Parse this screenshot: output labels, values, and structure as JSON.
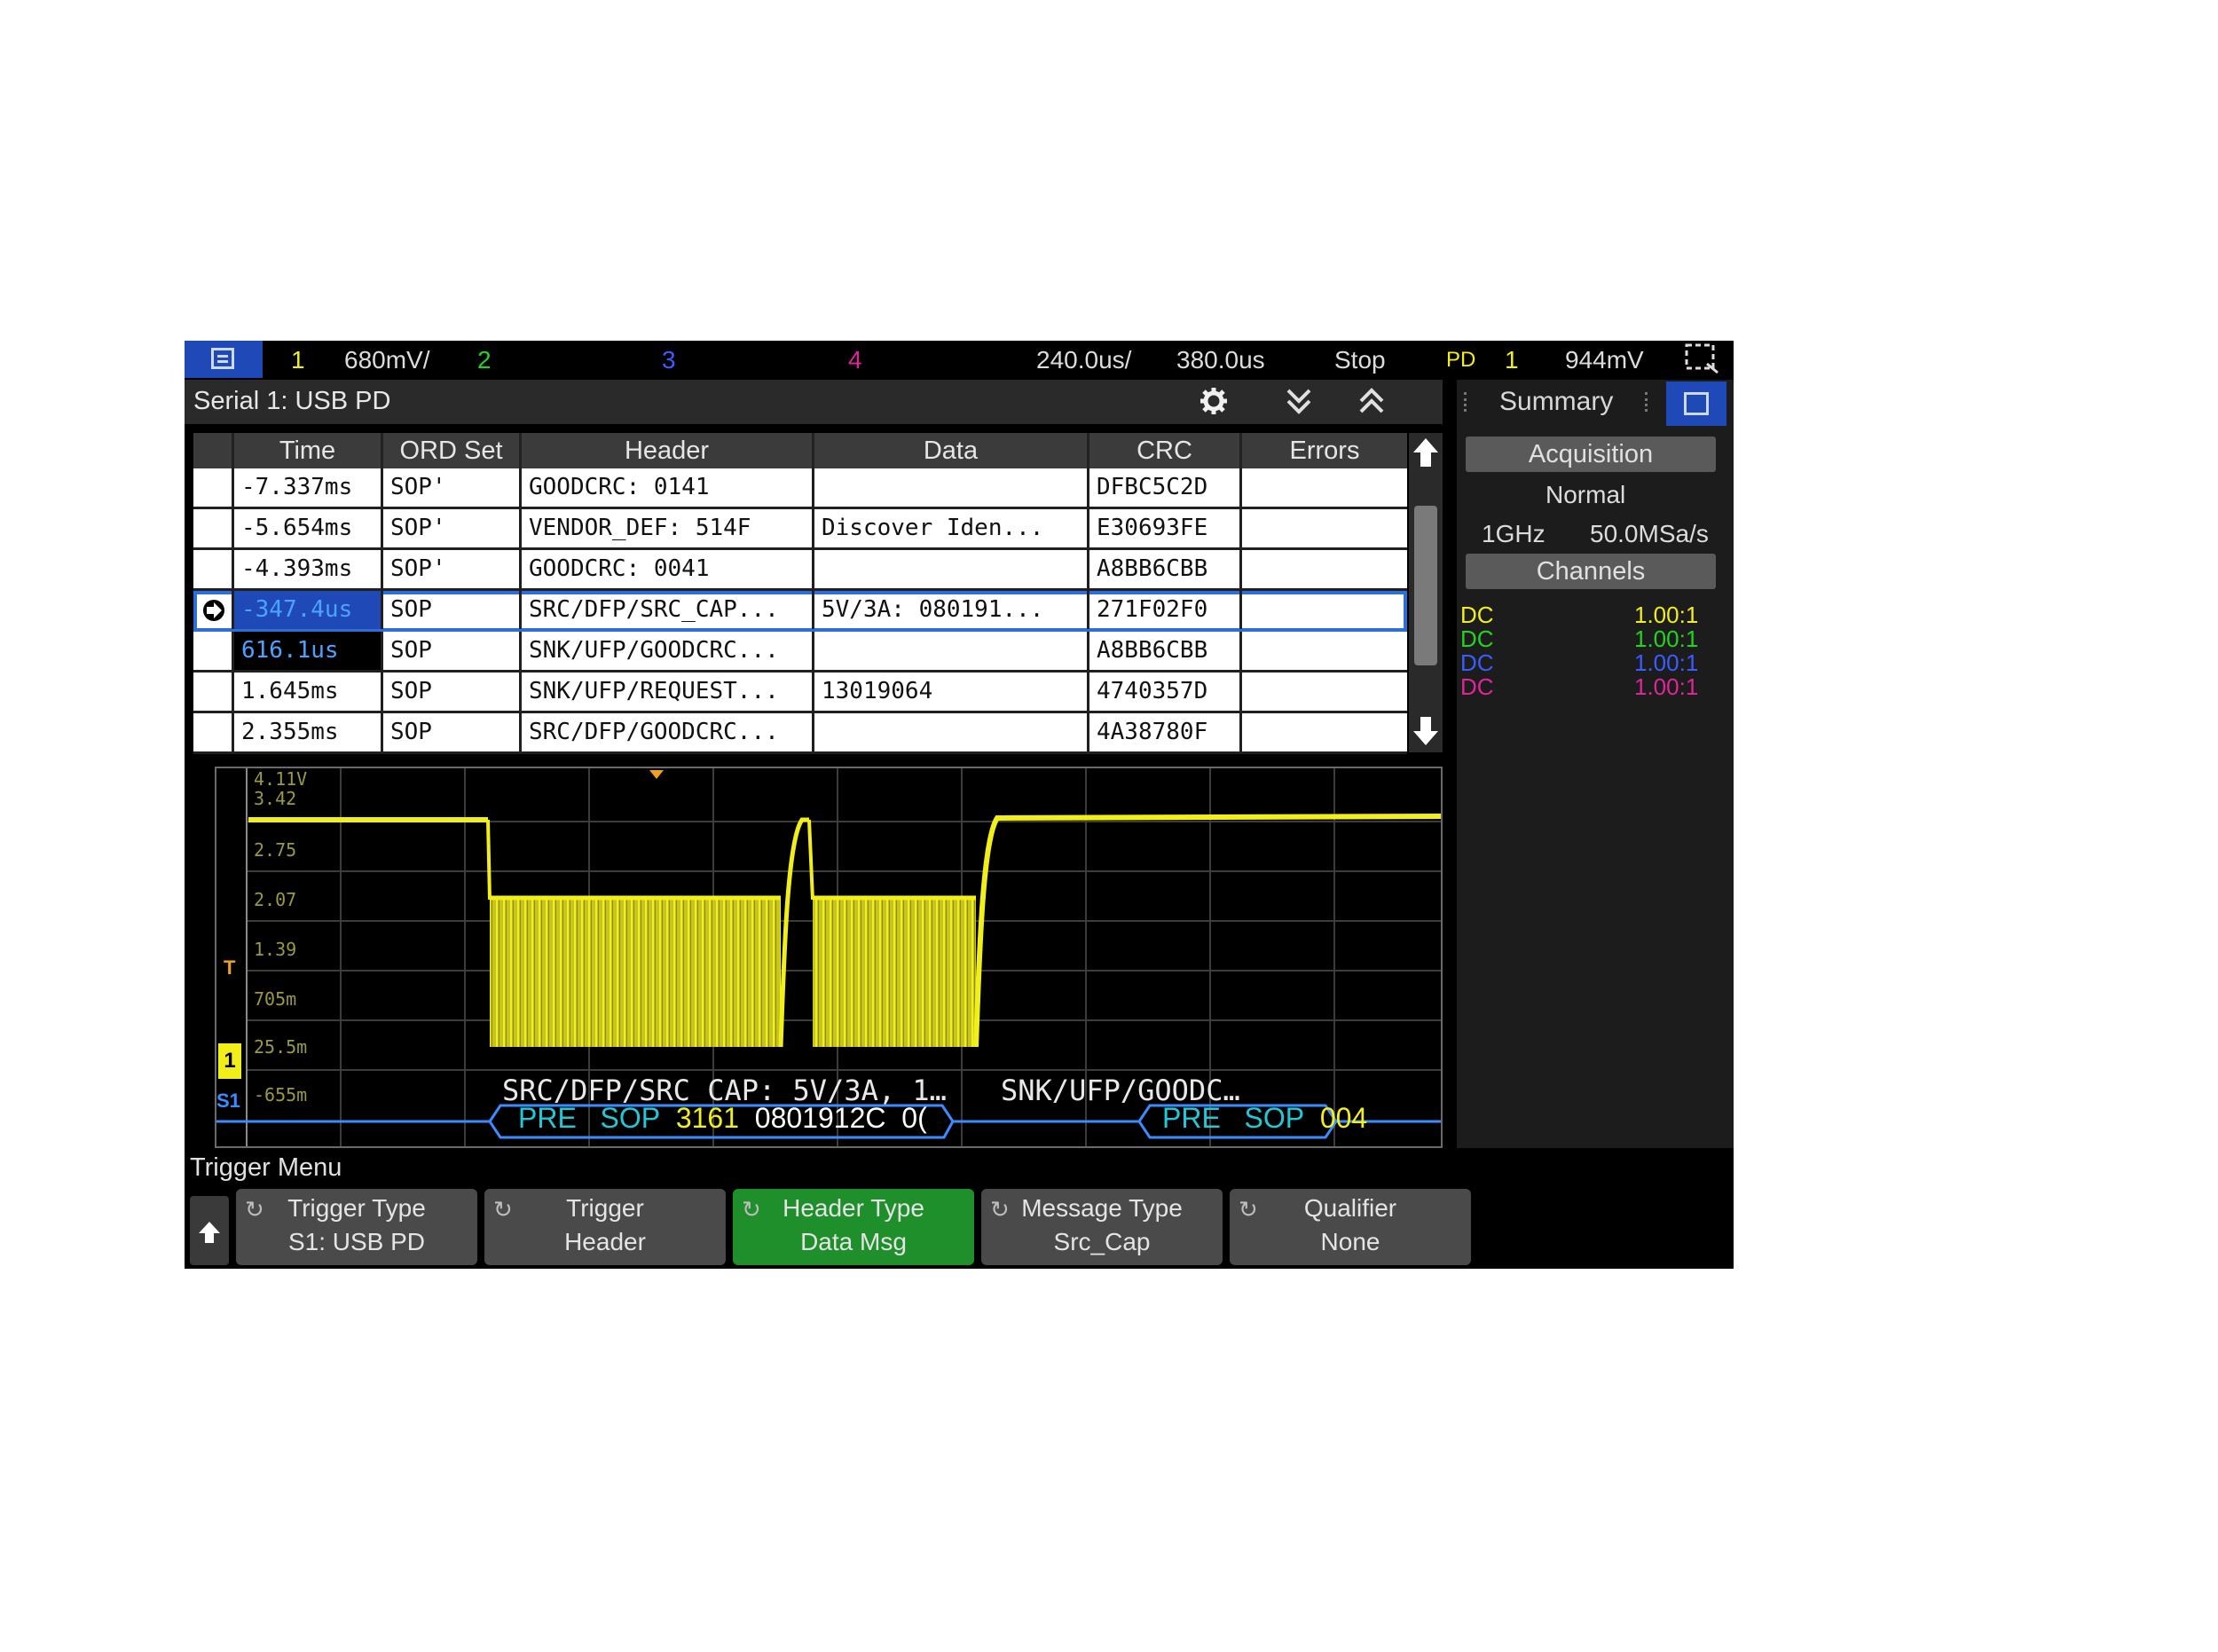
{
  "topbar": {
    "ch1_num": "1",
    "ch1_scale": "680mV/",
    "ch2_num": "2",
    "ch3_num": "3",
    "ch4_num": "4",
    "timebase": "240.0us/",
    "delay": "380.0us",
    "run_state": "Stop",
    "trig_label": "PD",
    "trig_source": "1",
    "trig_level": "944mV",
    "colors": {
      "ch1": "#f2ee1a",
      "ch2": "#22d41e",
      "ch3": "#3b5cff",
      "ch4": "#e0259a"
    }
  },
  "serial_panel": {
    "title": "Serial 1: USB PD",
    "columns": [
      "Time",
      "ORD Set",
      "Header",
      "Data",
      "CRC",
      "Errors"
    ],
    "rows": [
      {
        "time": "-7.337ms",
        "ord": "SOP'",
        "header": "GOODCRC: 0141",
        "data": "",
        "crc": "DFBC5C2D",
        "errors": ""
      },
      {
        "time": "-5.654ms",
        "ord": "SOP'",
        "header": "VENDOR_DEF: 514F",
        "data": "Discover Iden...",
        "crc": "E30693FE",
        "errors": ""
      },
      {
        "time": "-4.393ms",
        "ord": "SOP'",
        "header": "GOODCRC: 0041",
        "data": "",
        "crc": "A8BB6CBB",
        "errors": ""
      },
      {
        "time": "-347.4us",
        "ord": "SOP",
        "header": "SRC/DFP/SRC_CAP...",
        "data": "5V/3A: 080191...",
        "crc": "271F02F0",
        "errors": ""
      },
      {
        "time": "616.1us",
        "ord": "SOP",
        "header": "SNK/UFP/GOODCRC...",
        "data": "",
        "crc": "A8BB6CBB",
        "errors": ""
      },
      {
        "time": "1.645ms",
        "ord": "SOP",
        "header": "SNK/UFP/REQUEST...",
        "data": "13019064",
        "crc": "4740357D",
        "errors": ""
      },
      {
        "time": "2.355ms",
        "ord": "SOP",
        "header": "SRC/DFP/GOODCRC...",
        "data": "",
        "crc": "4A38780F",
        "errors": ""
      }
    ]
  },
  "waveform": {
    "y_labels": [
      "4.11V",
      "3.42",
      "2.75",
      "2.07",
      "1.39",
      "705m",
      "25.5m",
      "-655m"
    ],
    "decode_top_1": "SRC/DFP/SRC_CAP: 5V/3A, 1…",
    "decode_top_2": "SNK/UFP/GOODC…",
    "lane1": {
      "pre": "PRE",
      "sop": "SOP",
      "hdr": "3161",
      "data": "0801912C",
      "tail": "0("
    },
    "lane2": {
      "pre": "PRE",
      "sop": "SOP",
      "hdr": "004"
    },
    "trigger_marker": "T",
    "ch1_marker": "1",
    "serial_marker": "S1"
  },
  "right_panel": {
    "tab": "Summary",
    "acquisition_label": "Acquisition",
    "mode": "Normal",
    "bandwidth": "1GHz",
    "sample_rate": "50.0MSa/s",
    "channels_label": "Channels",
    "channels": [
      {
        "coupling": "DC",
        "probe": "1.00:1",
        "color": "#f2ee1a"
      },
      {
        "coupling": "DC",
        "probe": "1.00:1",
        "color": "#22d41e"
      },
      {
        "coupling": "DC",
        "probe": "1.00:1",
        "color": "#3b5cff"
      },
      {
        "coupling": "DC",
        "probe": "1.00:1",
        "color": "#e0259a"
      }
    ]
  },
  "trigger_menu": {
    "title": "Trigger Menu",
    "softkeys": [
      {
        "line1": "Trigger Type",
        "line2": "S1: USB PD"
      },
      {
        "line1": "Trigger",
        "line2": "Header"
      },
      {
        "line1": "Header Type",
        "line2": "Data Msg"
      },
      {
        "line1": "Message Type",
        "line2": "Src_Cap"
      },
      {
        "line1": "Qualifier",
        "line2": "None"
      }
    ]
  }
}
